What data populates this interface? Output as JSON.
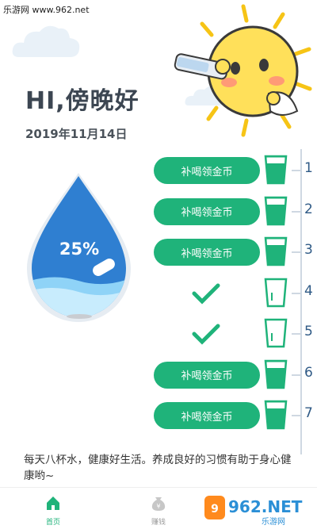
{
  "watermark": "乐游网 www.962.net",
  "greeting": "HI,傍晚好",
  "date": "2019年11月14日",
  "progress": {
    "label": "25%",
    "value": 0.25
  },
  "schedule": [
    {
      "index": "1",
      "state": "claim",
      "cup": "full",
      "label": "补喝领金币"
    },
    {
      "index": "2",
      "state": "claim",
      "cup": "full",
      "label": "补喝领金币"
    },
    {
      "index": "3",
      "state": "claim",
      "cup": "full",
      "label": "补喝领金币"
    },
    {
      "index": "4",
      "state": "done",
      "cup": "empty",
      "label": ""
    },
    {
      "index": "5",
      "state": "done",
      "cup": "empty",
      "label": ""
    },
    {
      "index": "6",
      "state": "claim",
      "cup": "full",
      "label": "补喝领金币"
    },
    {
      "index": "7",
      "state": "claim",
      "cup": "full",
      "label": "补喝领金币"
    }
  ],
  "tip": "每天八杯水，健康好生活。养成良好的习惯有助于身心健康哟~",
  "tabs": {
    "home": "首页",
    "earn": "赚钱"
  },
  "brand": {
    "text": "962.NET",
    "sub": "乐游网"
  },
  "colors": {
    "accent": "#1fb37a",
    "water": "#2f7fd1",
    "title": "#3c4652"
  },
  "icons": {
    "home": "home-icon",
    "earn": "yen-bag-icon",
    "check": "check-icon",
    "cup": "water-cup-icon"
  }
}
